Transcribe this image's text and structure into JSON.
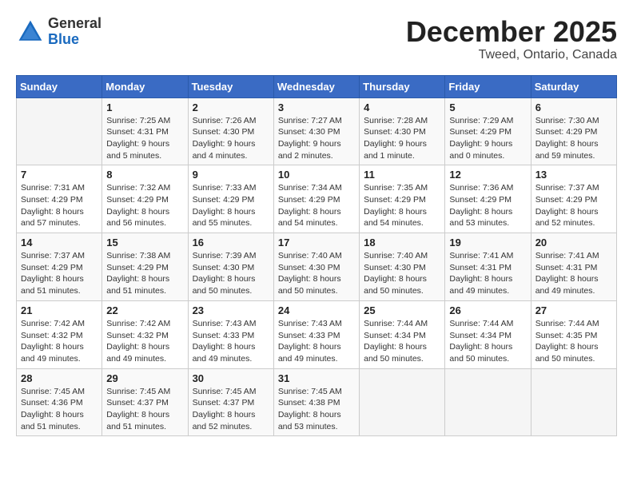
{
  "logo": {
    "general": "General",
    "blue": "Blue"
  },
  "title": "December 2025",
  "location": "Tweed, Ontario, Canada",
  "weekdays": [
    "Sunday",
    "Monday",
    "Tuesday",
    "Wednesday",
    "Thursday",
    "Friday",
    "Saturday"
  ],
  "weeks": [
    [
      {
        "day": "",
        "info": ""
      },
      {
        "day": "1",
        "info": "Sunrise: 7:25 AM\nSunset: 4:31 PM\nDaylight: 9 hours\nand 5 minutes."
      },
      {
        "day": "2",
        "info": "Sunrise: 7:26 AM\nSunset: 4:30 PM\nDaylight: 9 hours\nand 4 minutes."
      },
      {
        "day": "3",
        "info": "Sunrise: 7:27 AM\nSunset: 4:30 PM\nDaylight: 9 hours\nand 2 minutes."
      },
      {
        "day": "4",
        "info": "Sunrise: 7:28 AM\nSunset: 4:30 PM\nDaylight: 9 hours\nand 1 minute."
      },
      {
        "day": "5",
        "info": "Sunrise: 7:29 AM\nSunset: 4:29 PM\nDaylight: 9 hours\nand 0 minutes."
      },
      {
        "day": "6",
        "info": "Sunrise: 7:30 AM\nSunset: 4:29 PM\nDaylight: 8 hours\nand 59 minutes."
      }
    ],
    [
      {
        "day": "7",
        "info": "Sunrise: 7:31 AM\nSunset: 4:29 PM\nDaylight: 8 hours\nand 57 minutes."
      },
      {
        "day": "8",
        "info": "Sunrise: 7:32 AM\nSunset: 4:29 PM\nDaylight: 8 hours\nand 56 minutes."
      },
      {
        "day": "9",
        "info": "Sunrise: 7:33 AM\nSunset: 4:29 PM\nDaylight: 8 hours\nand 55 minutes."
      },
      {
        "day": "10",
        "info": "Sunrise: 7:34 AM\nSunset: 4:29 PM\nDaylight: 8 hours\nand 54 minutes."
      },
      {
        "day": "11",
        "info": "Sunrise: 7:35 AM\nSunset: 4:29 PM\nDaylight: 8 hours\nand 54 minutes."
      },
      {
        "day": "12",
        "info": "Sunrise: 7:36 AM\nSunset: 4:29 PM\nDaylight: 8 hours\nand 53 minutes."
      },
      {
        "day": "13",
        "info": "Sunrise: 7:37 AM\nSunset: 4:29 PM\nDaylight: 8 hours\nand 52 minutes."
      }
    ],
    [
      {
        "day": "14",
        "info": "Sunrise: 7:37 AM\nSunset: 4:29 PM\nDaylight: 8 hours\nand 51 minutes."
      },
      {
        "day": "15",
        "info": "Sunrise: 7:38 AM\nSunset: 4:29 PM\nDaylight: 8 hours\nand 51 minutes."
      },
      {
        "day": "16",
        "info": "Sunrise: 7:39 AM\nSunset: 4:30 PM\nDaylight: 8 hours\nand 50 minutes."
      },
      {
        "day": "17",
        "info": "Sunrise: 7:40 AM\nSunset: 4:30 PM\nDaylight: 8 hours\nand 50 minutes."
      },
      {
        "day": "18",
        "info": "Sunrise: 7:40 AM\nSunset: 4:30 PM\nDaylight: 8 hours\nand 50 minutes."
      },
      {
        "day": "19",
        "info": "Sunrise: 7:41 AM\nSunset: 4:31 PM\nDaylight: 8 hours\nand 49 minutes."
      },
      {
        "day": "20",
        "info": "Sunrise: 7:41 AM\nSunset: 4:31 PM\nDaylight: 8 hours\nand 49 minutes."
      }
    ],
    [
      {
        "day": "21",
        "info": "Sunrise: 7:42 AM\nSunset: 4:32 PM\nDaylight: 8 hours\nand 49 minutes."
      },
      {
        "day": "22",
        "info": "Sunrise: 7:42 AM\nSunset: 4:32 PM\nDaylight: 8 hours\nand 49 minutes."
      },
      {
        "day": "23",
        "info": "Sunrise: 7:43 AM\nSunset: 4:33 PM\nDaylight: 8 hours\nand 49 minutes."
      },
      {
        "day": "24",
        "info": "Sunrise: 7:43 AM\nSunset: 4:33 PM\nDaylight: 8 hours\nand 49 minutes."
      },
      {
        "day": "25",
        "info": "Sunrise: 7:44 AM\nSunset: 4:34 PM\nDaylight: 8 hours\nand 50 minutes."
      },
      {
        "day": "26",
        "info": "Sunrise: 7:44 AM\nSunset: 4:34 PM\nDaylight: 8 hours\nand 50 minutes."
      },
      {
        "day": "27",
        "info": "Sunrise: 7:44 AM\nSunset: 4:35 PM\nDaylight: 8 hours\nand 50 minutes."
      }
    ],
    [
      {
        "day": "28",
        "info": "Sunrise: 7:45 AM\nSunset: 4:36 PM\nDaylight: 8 hours\nand 51 minutes."
      },
      {
        "day": "29",
        "info": "Sunrise: 7:45 AM\nSunset: 4:37 PM\nDaylight: 8 hours\nand 51 minutes."
      },
      {
        "day": "30",
        "info": "Sunrise: 7:45 AM\nSunset: 4:37 PM\nDaylight: 8 hours\nand 52 minutes."
      },
      {
        "day": "31",
        "info": "Sunrise: 7:45 AM\nSunset: 4:38 PM\nDaylight: 8 hours\nand 53 minutes."
      },
      {
        "day": "",
        "info": ""
      },
      {
        "day": "",
        "info": ""
      },
      {
        "day": "",
        "info": ""
      }
    ]
  ]
}
